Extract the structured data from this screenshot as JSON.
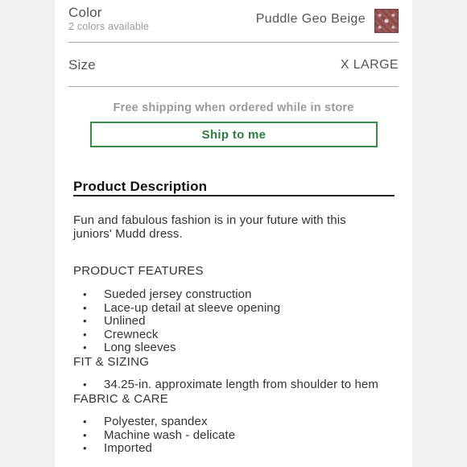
{
  "color": {
    "label": "Color",
    "available": "2 colors available",
    "selected": "Puddle Geo Beige",
    "swatch_colors": [
      "#8a4a4a",
      "#e8c9c9"
    ]
  },
  "size": {
    "label": "Size",
    "selected": "X LARGE"
  },
  "shipping": {
    "note": "Free shipping when ordered while in store",
    "button_label": "Ship to me",
    "accent_color": "#3b8a48"
  },
  "description": {
    "title": "Product Description",
    "intro": "Fun and fabulous fashion is in your future with this juniors' Mudd dress.",
    "features_heading": "PRODUCT FEATURES",
    "features": [
      "Sueded jersey construction",
      "Lace-up detail at sleeve opening",
      "Unlined",
      "Crewneck",
      "Long sleeves"
    ],
    "fit_heading": "FIT & SIZING",
    "fit": [
      "34.25-in. approximate length from shoulder to hem"
    ],
    "fabric_heading": "FABRIC & CARE",
    "fabric": [
      "Polyester, spandex",
      "Machine wash - delicate",
      "Imported"
    ],
    "bullet_glyph": "•"
  }
}
